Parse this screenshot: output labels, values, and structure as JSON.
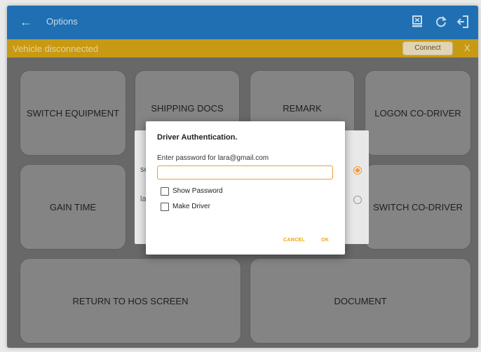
{
  "appbar": {
    "title": "Options",
    "back_icon": "arrow-left-icon"
  },
  "banner": {
    "message": "Vehicle disconnected",
    "connect_label": "Connect",
    "close_label": "X"
  },
  "tiles": {
    "switch_equipment": "SWITCH EQUIPMENT",
    "shipping_docs": "SHIPPING DOCS",
    "remark": "REMARK",
    "logon_codriver": "LOGON CO-DRIVER",
    "gain_time": "GAIN TIME",
    "switch_codriver": "SWITCH CO-DRIVER",
    "return_hos": "RETURN TO HOS SCREEN",
    "document": "DOCUMENT"
  },
  "bg_dialog": {
    "frag_1": "se",
    "frag_2": "la"
  },
  "dialog": {
    "title": "Driver Authentication.",
    "prompt": "Enter password for lara@gmail.com",
    "password_value": "",
    "show_password": "Show Password",
    "make_driver": "Make Driver",
    "cancel": "CANCEL",
    "ok": "OK"
  },
  "colors": {
    "appbar": "#1f6fb2",
    "banner": "#c89a14",
    "accent": "#f39a3c",
    "button_text": "#f2a300"
  }
}
